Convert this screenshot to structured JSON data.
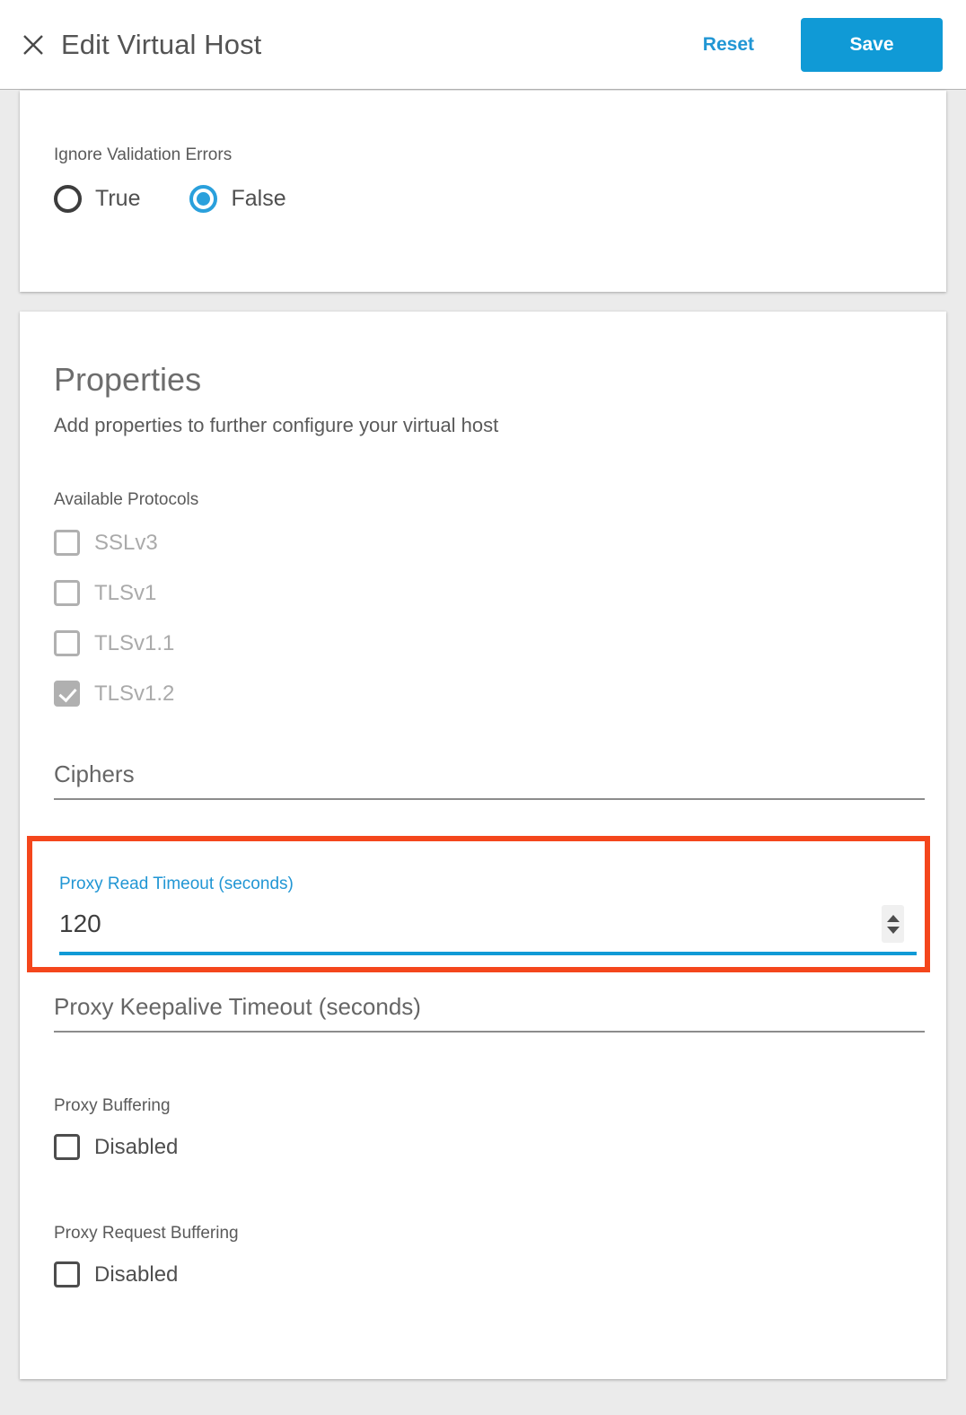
{
  "header": {
    "close_icon": "close-icon",
    "title": "Edit Virtual Host",
    "reset_label": "Reset",
    "save_label": "Save",
    "accent_color": "#109ad6",
    "link_color": "#2196d4"
  },
  "validation_card": {
    "label": "Ignore Validation Errors",
    "options": [
      {
        "label": "True",
        "selected": false
      },
      {
        "label": "False",
        "selected": true
      }
    ]
  },
  "properties_card": {
    "title": "Properties",
    "subtitle": "Add properties to further configure your virtual host",
    "protocols_label": "Available Protocols",
    "protocols": [
      {
        "label": "SSLv3",
        "checked": false,
        "disabled": true
      },
      {
        "label": "TLSv1",
        "checked": false,
        "disabled": true
      },
      {
        "label": "TLSv1.1",
        "checked": false,
        "disabled": true
      },
      {
        "label": "TLSv1.2",
        "checked": true,
        "disabled": true
      }
    ],
    "ciphers": {
      "placeholder": "Ciphers",
      "value": ""
    },
    "proxy_read_timeout": {
      "label": "Proxy Read Timeout (seconds)",
      "value": "120",
      "focused": true,
      "highlight_color": "#f4461c"
    },
    "proxy_keepalive_timeout": {
      "placeholder": "Proxy Keepalive Timeout (seconds)",
      "value": ""
    },
    "proxy_buffering": {
      "label": "Proxy Buffering",
      "checkbox_label": "Disabled",
      "checked": false
    },
    "proxy_request_buffering": {
      "label": "Proxy Request Buffering",
      "checkbox_label": "Disabled",
      "checked": false
    }
  }
}
